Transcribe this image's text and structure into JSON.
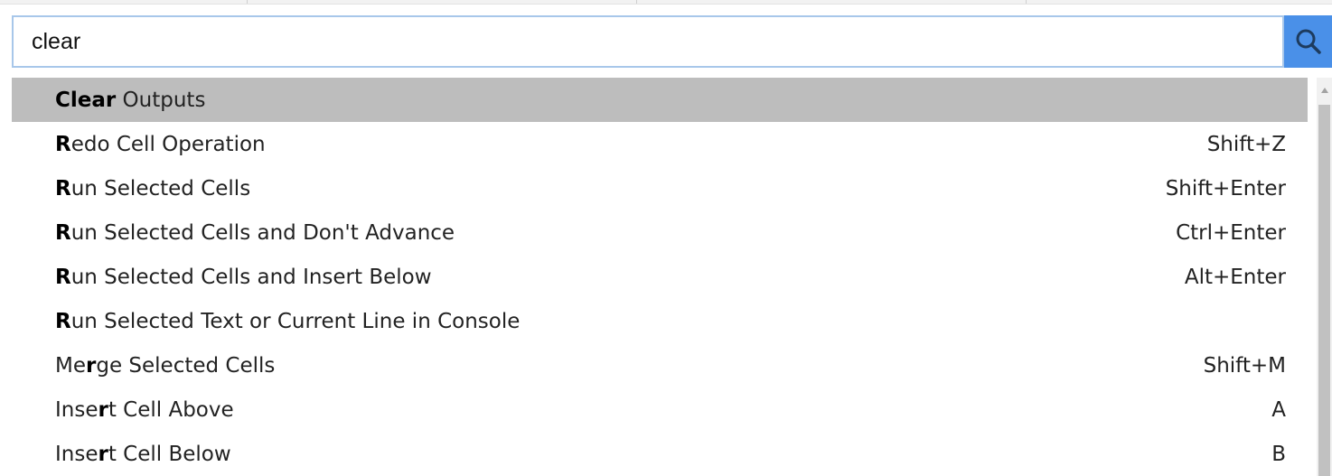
{
  "search": {
    "value": "clear",
    "icon": "search-icon",
    "button_color": "#4a90e8"
  },
  "results": [
    {
      "pre": "",
      "bold": "Clear",
      "post": " Outputs",
      "shortcut": "",
      "selected": true
    },
    {
      "pre": "",
      "bold": "R",
      "post": "edo Cell Operation",
      "shortcut": "Shift+Z",
      "selected": false
    },
    {
      "pre": "",
      "bold": "R",
      "post": "un Selected Cells",
      "shortcut": "Shift+Enter",
      "selected": false
    },
    {
      "pre": "",
      "bold": "R",
      "post": "un Selected Cells and Don't Advance",
      "shortcut": "Ctrl+Enter",
      "selected": false
    },
    {
      "pre": "",
      "bold": "R",
      "post": "un Selected Cells and Insert Below",
      "shortcut": "Alt+Enter",
      "selected": false
    },
    {
      "pre": "",
      "bold": "R",
      "post": "un Selected Text or Current Line in Console",
      "shortcut": "",
      "selected": false
    },
    {
      "pre": "Me",
      "bold": "r",
      "post": "ge Selected Cells",
      "shortcut": "Shift+M",
      "selected": false
    },
    {
      "pre": "Inse",
      "bold": "r",
      "post": "t Cell Above",
      "shortcut": "A",
      "selected": false
    },
    {
      "pre": "Inse",
      "bold": "r",
      "post": "t Cell Below",
      "shortcut": "B",
      "selected": false
    }
  ],
  "colors": {
    "selected_row": "#bdbdbd",
    "input_border": "#a8c7ea"
  }
}
